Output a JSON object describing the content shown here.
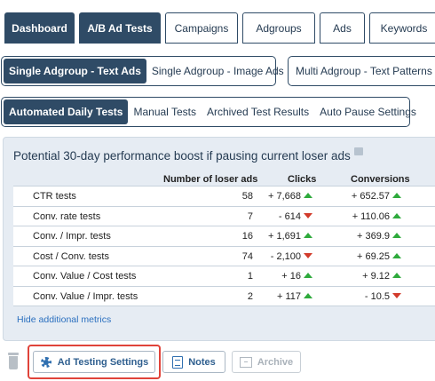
{
  "top_tabs": [
    {
      "label": "Dashboard",
      "active": true
    },
    {
      "label": "A/B Ad Tests",
      "active": true
    },
    {
      "label": "Campaigns",
      "active": false
    },
    {
      "label": "Adgroups",
      "active": false
    },
    {
      "label": "Ads",
      "active": false
    },
    {
      "label": "Keywords",
      "active": false
    }
  ],
  "ad_types": [
    {
      "label": "Single Adgroup - Text Ads",
      "active": true
    },
    {
      "label": "Single Adgroup - Image Ads",
      "active": false
    },
    {
      "label": "Multi Adgroup - Text Patterns",
      "active": false
    }
  ],
  "test_views": [
    {
      "label": "Automated Daily Tests",
      "active": true
    },
    {
      "label": "Manual Tests",
      "active": false
    },
    {
      "label": "Archived Test Results",
      "active": false
    },
    {
      "label": "Auto Pause Settings",
      "active": false
    }
  ],
  "panel": {
    "title": "Potential 30-day performance boost if pausing current loser ads",
    "headers": {
      "count": "Number of loser ads",
      "clicks": "Clicks",
      "conversions": "Conversions"
    },
    "rows": [
      {
        "name": "CTR tests",
        "count": "58",
        "clicks": "+ 7,668",
        "clicks_trend": "up",
        "conv": "+ 652.57",
        "conv_trend": "up",
        "edge": "+"
      },
      {
        "name": "Conv. rate tests",
        "count": "7",
        "clicks": "- 614",
        "clicks_trend": "down",
        "conv": "+ 110.06",
        "conv_trend": "up",
        "edge": "-"
      },
      {
        "name": "Conv. / Impr. tests",
        "count": "16",
        "clicks": "+ 1,691",
        "clicks_trend": "up",
        "conv": "+ 369.9",
        "conv_trend": "up",
        "edge": "+"
      },
      {
        "name": "Cost / Conv. tests",
        "count": "74",
        "clicks": "- 2,100",
        "clicks_trend": "down",
        "conv": "+ 69.25",
        "conv_trend": "up",
        "edge": "+"
      },
      {
        "name": "Conv. Value / Cost tests",
        "count": "1",
        "clicks": "+ 16",
        "clicks_trend": "up",
        "conv": "+ 9.12",
        "conv_trend": "up",
        "edge": "-"
      },
      {
        "name": "Conv. Value / Impr. tests",
        "count": "2",
        "clicks": "+ 117",
        "clicks_trend": "up",
        "conv": "- 10.5",
        "conv_trend": "down",
        "edge": "-"
      }
    ],
    "hide_link": "Hide additional metrics"
  },
  "actions": {
    "settings_label": "Ad Testing Settings",
    "notes_label": "Notes",
    "archive_label": "Archive"
  },
  "colors": {
    "primary": "#2f4b66",
    "up": "#2eaa3c",
    "down": "#d23b2b",
    "highlight": "#e0433a"
  }
}
